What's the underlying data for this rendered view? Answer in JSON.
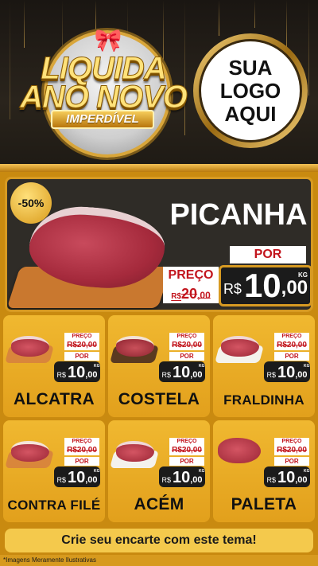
{
  "header": {
    "title_line1": "LIQUIDA",
    "title_line2": "ANO NOVO",
    "ribbon": "IMPERDÍVEL",
    "logo_line1": "SUA",
    "logo_line2": "LOGO",
    "logo_line3": "AQUI"
  },
  "featured": {
    "discount": "-50%",
    "name": "PICANHA",
    "old_label": "PREÇO",
    "old_currency": "R$",
    "old_int": "20",
    "old_dec": ",00",
    "new_label": "POR",
    "new_currency": "R$",
    "new_int": "10",
    "new_dec": ",00",
    "unit": "KG"
  },
  "products": [
    {
      "name": "ALCATRA",
      "old_label": "PREÇO",
      "old_price": "R$20,00",
      "new_label": "POR",
      "currency": "R$",
      "int": "10",
      "dec": ",00",
      "unit": "KG"
    },
    {
      "name": "COSTELA",
      "old_label": "PREÇO",
      "old_price": "R$20,00",
      "new_label": "POR",
      "currency": "R$",
      "int": "10",
      "dec": ",00",
      "unit": "KG"
    },
    {
      "name": "FRALDINHA",
      "old_label": "PREÇO",
      "old_price": "R$20,00",
      "new_label": "POR",
      "currency": "R$",
      "int": "10",
      "dec": ",00",
      "unit": "KG"
    },
    {
      "name": "CONTRA FILÉ",
      "old_label": "PREÇO",
      "old_price": "R$20,00",
      "new_label": "POR",
      "currency": "R$",
      "int": "10",
      "dec": ",00",
      "unit": "KG"
    },
    {
      "name": "ACÉM",
      "old_label": "PREÇO",
      "old_price": "R$20,00",
      "new_label": "POR",
      "currency": "R$",
      "int": "10",
      "dec": ",00",
      "unit": "KG"
    },
    {
      "name": "PALETA",
      "old_label": "PREÇO",
      "old_price": "R$20,00",
      "new_label": "POR",
      "currency": "R$",
      "int": "10",
      "dec": ",00",
      "unit": "KG"
    }
  ],
  "cta": "Crie seu encarte com este tema!",
  "footer_note": "*Imagens Meramente Ilustrativas",
  "colors": {
    "gold": "#d79a22",
    "dark": "#2f2c27",
    "price_red": "#c2151d",
    "card_yellow": "#f0b830"
  }
}
